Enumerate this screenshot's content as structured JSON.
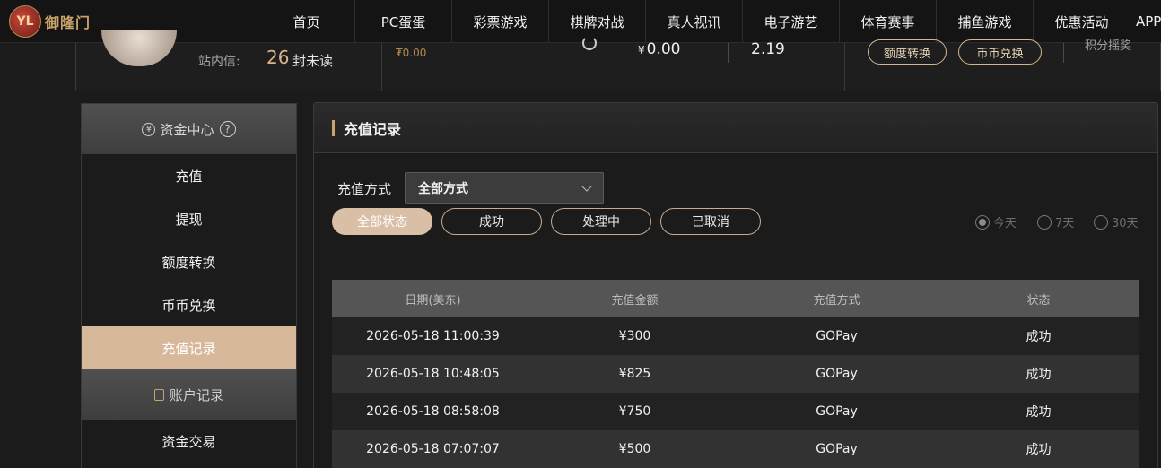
{
  "brand": {
    "logo_mark": "YL",
    "logo_text": "御隆门"
  },
  "nav": [
    "首页",
    "PC蛋蛋",
    "彩票游戏",
    "棋牌对战",
    "真人视讯",
    "电子游艺",
    "体育赛事",
    "捕鱼游戏",
    "优惠活动",
    "APP"
  ],
  "user": {
    "msg_label": "站内信:",
    "msg_count": "26",
    "msg_unread": "封未读",
    "balance_sub": "₮0.00",
    "money_currency": "¥",
    "money_value": "0.00",
    "points": "2.19",
    "quota_transfer": "额度转换",
    "coin_exchange": "币币兑换",
    "lottery": "积分摇奖"
  },
  "sidebar": {
    "fund_center": "资金中心",
    "fund_icon": "¥",
    "help": "?",
    "items": [
      "充值",
      "提现",
      "额度转换",
      "币币兑换",
      "充值记录"
    ],
    "active_index": 4,
    "account_records": "账户记录",
    "sub_items": [
      "资金交易"
    ]
  },
  "panel": {
    "title": "充值记录",
    "filter_label": "充值方式",
    "select_value": "全部方式",
    "statuses": [
      "全部状态",
      "成功",
      "处理中",
      "已取消"
    ],
    "ranges": [
      "今天",
      "7天",
      "30天"
    ],
    "selected_range": 0
  },
  "table": {
    "headers": [
      "日期(美东)",
      "充值金额",
      "充值方式",
      "状态"
    ],
    "rows": [
      [
        "2026-05-18 11:00:39",
        "¥300",
        "GOPay",
        "成功"
      ],
      [
        "2026-05-18 10:48:05",
        "¥825",
        "GOPay",
        "成功"
      ],
      [
        "2026-05-18 08:58:08",
        "¥750",
        "GOPay",
        "成功"
      ],
      [
        "2026-05-18 07:07:07",
        "¥500",
        "GOPay",
        "成功"
      ]
    ]
  },
  "colors": {
    "accent": "#d7b89b",
    "gold": "#c9a36a",
    "background": "#1b1b1b"
  }
}
